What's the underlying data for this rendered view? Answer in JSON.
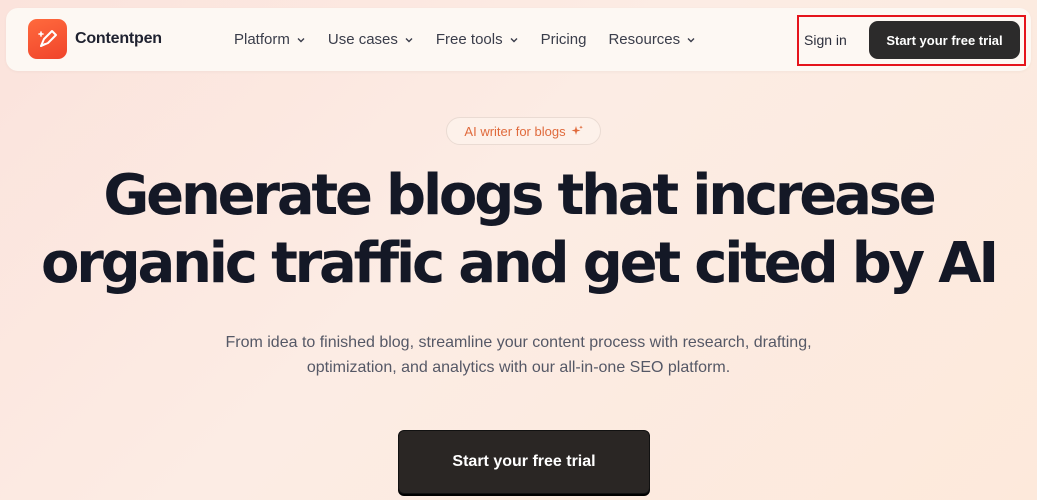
{
  "brand": {
    "name": "Contentpen",
    "accent": "#f0442b",
    "logo_icon": "pen-sparkle-icon"
  },
  "nav": {
    "items": [
      {
        "label": "Platform",
        "has_dropdown": true
      },
      {
        "label": "Use cases",
        "has_dropdown": true
      },
      {
        "label": "Free tools",
        "has_dropdown": true
      },
      {
        "label": "Pricing",
        "has_dropdown": false
      },
      {
        "label": "Resources",
        "has_dropdown": true
      }
    ],
    "signin_label": "Sign in",
    "cta_label": "Start your free trial"
  },
  "hero": {
    "badge_label": "AI writer for blogs",
    "badge_icon": "sparkle-icon",
    "headline_line1": "Generate blogs that increase",
    "headline_line2": "organic traffic and get cited by AI",
    "subtext_line1": "From idea to finished blog, streamline your content process with research, drafting,",
    "subtext_line2": "optimization, and analytics with our all-in-one SEO platform.",
    "cta_label": "Start your free trial"
  },
  "colors": {
    "highlight_border": "#e5141b",
    "button_dark": "#2c2b2b",
    "badge_text": "#e06a3c"
  }
}
